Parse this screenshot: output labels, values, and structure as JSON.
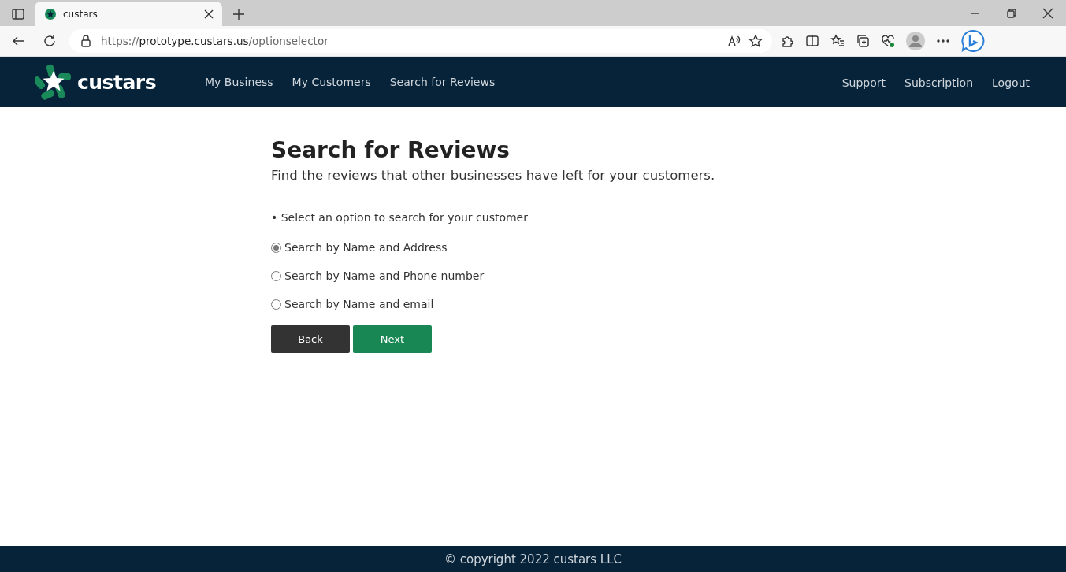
{
  "browser": {
    "tab": {
      "title": "custars",
      "selected": true
    },
    "url": {
      "scheme": "https://",
      "host": "prototype.custars.us",
      "path": "/optionselector"
    }
  },
  "navbar": {
    "brand": "custars",
    "left_links": [
      "My Business",
      "My Customers",
      "Search for Reviews"
    ],
    "right_links": [
      "Support",
      "Subscription",
      "Logout"
    ]
  },
  "page": {
    "title": "Search for Reviews",
    "subtitle": "Find the reviews that other businesses have left for your customers.",
    "instruction": "• Select an option to search for your customer",
    "options": [
      {
        "label": "Search by Name and Address",
        "selected": true
      },
      {
        "label": "Search by Name and Phone number",
        "selected": false
      },
      {
        "label": "Search by Name and email",
        "selected": false
      }
    ],
    "buttons": [
      {
        "label": "Back",
        "kind": "secondary"
      },
      {
        "label": "Next",
        "kind": "primary"
      }
    ]
  },
  "footer": {
    "text": "© copyright 2022 custars LLC"
  }
}
